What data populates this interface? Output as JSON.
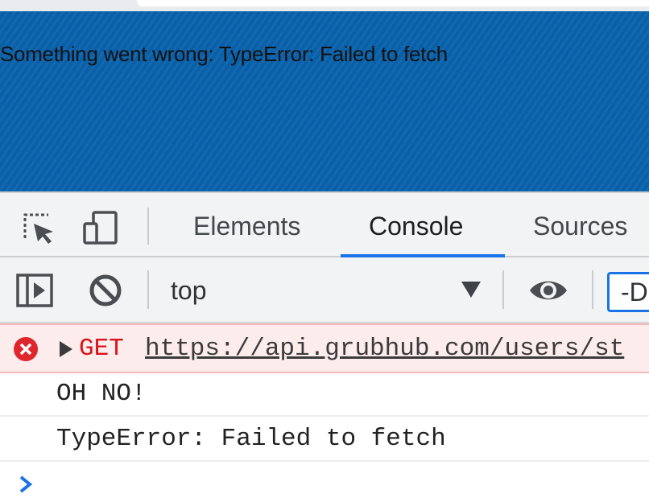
{
  "page": {
    "banner_message": "Something went wrong: TypeError: Failed to fetch",
    "banner_color": "#0a63ad"
  },
  "devtools": {
    "toolbar_icons": [
      "inspect-element-icon",
      "device-toolbar-icon"
    ],
    "tabs": [
      {
        "label": "Elements",
        "active": false
      },
      {
        "label": "Console",
        "active": true
      },
      {
        "label": "Sources",
        "active": false
      }
    ],
    "console_toolbar": {
      "icons": [
        "sidebar-toggle-icon",
        "clear-console-icon",
        "live-expression-eye-icon"
      ],
      "context": "top",
      "filter_value": "-D"
    },
    "accent_color": "#1a73e8"
  },
  "console": {
    "error_row": {
      "method": "GET",
      "url": "https://api.grubhub.com/users/st",
      "color": "#d9141a"
    },
    "messages": [
      "OH NO!",
      "TypeError: Failed to fetch"
    ],
    "prompt_icon": "chevron-right-icon"
  }
}
